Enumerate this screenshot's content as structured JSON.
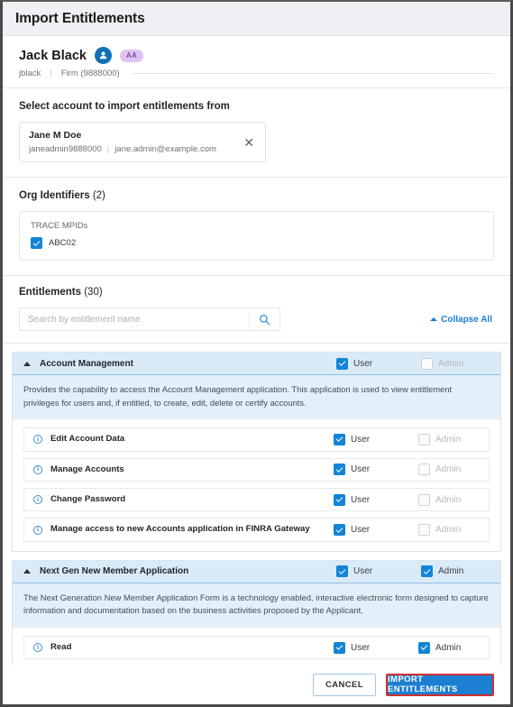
{
  "window": {
    "title": "Import Entitlements"
  },
  "user": {
    "name": "Jack Black",
    "avatar_icon": "person-icon",
    "badge": "AA",
    "username": "jblack",
    "separator": "|",
    "firm": "Firm (9888000)"
  },
  "select_account": {
    "title": "Select account to import entitlements from",
    "card": {
      "name": "Jane M Doe",
      "account_id": "janeadmin9888000",
      "divider": "|",
      "email": "jane.admin@example.com",
      "close_icon": "close-icon"
    }
  },
  "org_identifiers": {
    "title": "Org Identifiers",
    "count": "(2)",
    "group_label": "TRACE MPIDs",
    "items": [
      {
        "label": "ABC02",
        "checked": true
      }
    ]
  },
  "entitlements": {
    "title": "Entitlements",
    "count": "(30)",
    "search": {
      "placeholder": "Search by entitlement name",
      "value": "",
      "icon": "search-icon"
    },
    "collapse_all": "Collapse All",
    "collapse_icon": "chevron-up-icon",
    "groups": [
      {
        "name": "Account Management",
        "expanded": true,
        "user_label": "User",
        "user_checked": true,
        "admin_label": "Admin",
        "admin_checked": false,
        "admin_disabled": true,
        "description": "Provides the capability to access the Account Management application. This application is used to view entitlement privileges for users and, if entitled, to create, edit, delete or certify accounts.",
        "rows": [
          {
            "name": "Edit Account Data",
            "user_label": "User",
            "user_checked": true,
            "admin_label": "Admin",
            "admin_checked": false,
            "admin_disabled": true
          },
          {
            "name": "Manage Accounts",
            "user_label": "User",
            "user_checked": true,
            "admin_label": "Admin",
            "admin_checked": false,
            "admin_disabled": true
          },
          {
            "name": "Change Password",
            "user_label": "User",
            "user_checked": true,
            "admin_label": "Admin",
            "admin_checked": false,
            "admin_disabled": true
          },
          {
            "name": "Manage access to new Accounts application in FINRA Gateway",
            "user_label": "User",
            "user_checked": true,
            "admin_label": "Admin",
            "admin_checked": false,
            "admin_disabled": true
          }
        ]
      },
      {
        "name": "Next Gen New Member Application",
        "expanded": true,
        "user_label": "User",
        "user_checked": true,
        "admin_label": "Admin",
        "admin_checked": true,
        "admin_disabled": false,
        "description": "The Next Generation New Member Application Form is a technology enabled, interactive electronic form designed to capture information and documentation based on the business activities proposed by the Applicant.",
        "rows": [
          {
            "name": "Read",
            "user_label": "User",
            "user_checked": true,
            "admin_label": "Admin",
            "admin_checked": true,
            "admin_disabled": false
          }
        ]
      }
    ]
  },
  "footer": {
    "cancel_label": "CANCEL",
    "import_label": "IMPORT ENTITLEMENTS"
  },
  "colors": {
    "accent_blue": "#1d7fd1",
    "checkbox_blue": "#1484d6",
    "group_header_bg": "#dbeaf7",
    "group_desc_bg": "#e3f0fa",
    "badge_purple": "#e0c3f5",
    "focus_red": "#d12f2f",
    "link_blue": "#1a7fd4"
  }
}
